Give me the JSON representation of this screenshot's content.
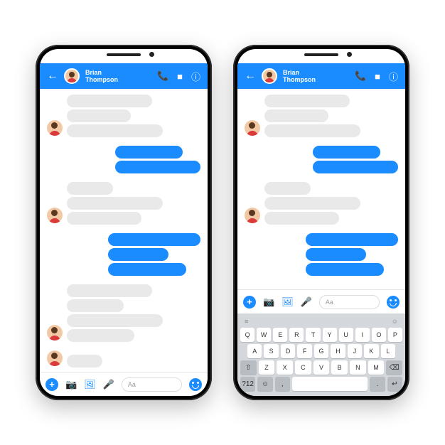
{
  "colors": {
    "primary": "#1a8cff",
    "bubble_received": "#e9e9e9",
    "keyboard_bg": "#d4d7dc"
  },
  "contact": {
    "first_name": "Brian",
    "last_name": "Thompson"
  },
  "header_icons": {
    "back": "←",
    "call": "📞",
    "video": "■",
    "info": "ⓘ"
  },
  "conversation": [
    {
      "type": "received",
      "widths": [
        120,
        90,
        135
      ]
    },
    {
      "type": "sent",
      "widths": [
        95,
        120
      ]
    },
    {
      "type": "received",
      "widths": [
        65,
        135,
        105
      ]
    },
    {
      "type": "sent",
      "widths": [
        130,
        85,
        110
      ]
    },
    {
      "type": "received",
      "widths": [
        120,
        80,
        135,
        95
      ]
    },
    {
      "type": "received",
      "widths": [
        50
      ]
    }
  ],
  "composer": {
    "placeholder": "Aa",
    "icons": {
      "add": "+",
      "camera": "📷",
      "gallery": "🖼",
      "mic": "🎤"
    }
  },
  "keyboard": {
    "top_left_icon": "≡",
    "top_right_icon": "☺",
    "rows": [
      [
        "Q",
        "W",
        "E",
        "R",
        "T",
        "Y",
        "U",
        "I",
        "O",
        "P"
      ],
      [
        "A",
        "S",
        "D",
        "F",
        "G",
        "H",
        "J",
        "K",
        "L"
      ]
    ],
    "row3_left": "⇧",
    "row3_keys": [
      "Z",
      "X",
      "C",
      "V",
      "B",
      "N",
      "M"
    ],
    "row3_right": "⌫",
    "row4": {
      "sym": "?12",
      "emoji": "☺",
      "comma": ",",
      "space": "",
      "dot": ".",
      "enter": "↵"
    }
  }
}
